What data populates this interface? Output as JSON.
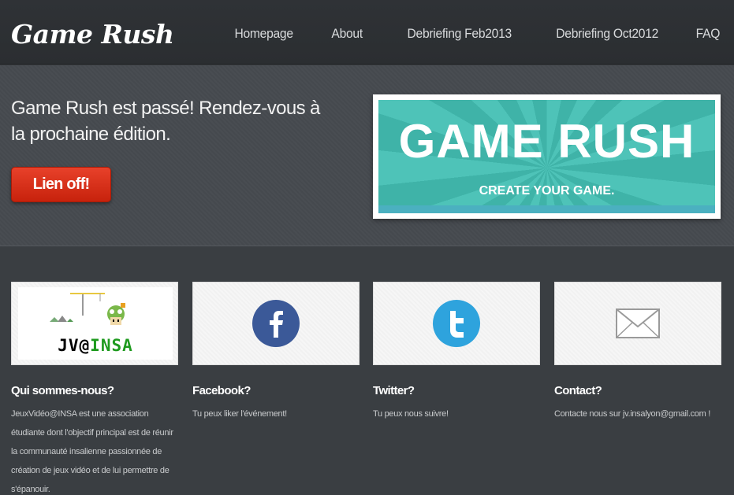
{
  "header": {
    "logo": "Game Rush",
    "nav": [
      "Homepage",
      "About",
      "Debriefing Feb2013",
      "Debriefing Oct2012",
      "FAQ"
    ]
  },
  "hero": {
    "text": "Game Rush est passé! Rendez-vous à la prochaine édition.",
    "button_label": "Lien off!",
    "banner_title": "GAME RUSH",
    "banner_subtitle": "CREATE YOUR GAME."
  },
  "cards": [
    {
      "icon": "jv-insa-logo",
      "logo_text_a": "JV@",
      "logo_text_b": "INSA",
      "title": "Qui sommes-nous?",
      "text": "JeuxVidéo@INSA est une association étudiante dont l'objectif principal est de réunir la communauté insalienne passionnée de création de jeux vidéo et de lui permettre de s'épanouir."
    },
    {
      "icon": "facebook-icon",
      "title": "Facebook?",
      "text": "Tu peux liker l'événement!"
    },
    {
      "icon": "twitter-icon",
      "title": "Twitter?",
      "text": "Tu peux nous suivre!"
    },
    {
      "icon": "mail-icon",
      "title": "Contact?",
      "text": "Contacte nous sur jv.insalyon@gmail.com !"
    }
  ],
  "colors": {
    "background": "#3a3e42",
    "button": "#d9301a",
    "banner": "#4ec3b8",
    "facebook": "#3b5998",
    "twitter": "#2ea3dd"
  }
}
